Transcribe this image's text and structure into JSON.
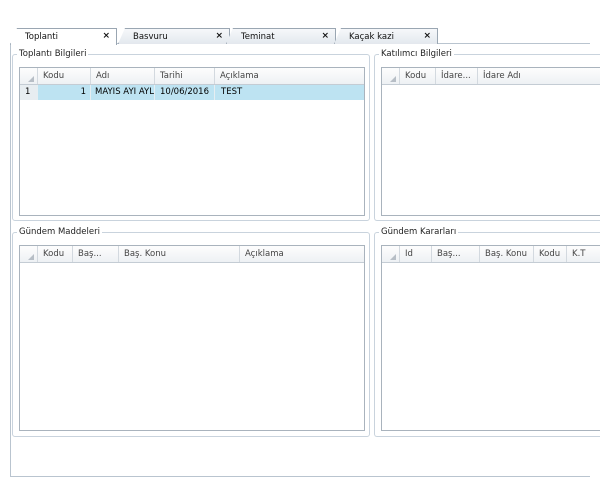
{
  "tabs": [
    {
      "label": "Toplanti",
      "active": true
    },
    {
      "label": "Basvuru",
      "active": false
    },
    {
      "label": "Teminat",
      "active": false
    },
    {
      "label": "Kaçak kazi",
      "active": false
    }
  ],
  "close_glyph": "×",
  "meeting_info": {
    "title": "Toplantı Bilgileri",
    "columns": [
      "Kodu",
      "Adı",
      "Tarihi",
      "Açıklama"
    ],
    "rows": [
      {
        "row_number": "1",
        "code": "1",
        "name": "MAYIS AYI AYLIK",
        "date": "10/06/2016",
        "description": "TEST"
      }
    ]
  },
  "participant_info": {
    "title": "Katılımcı Bilgileri",
    "columns": [
      "Kodu",
      "İdare...",
      "İdare Adı"
    ]
  },
  "agenda_items": {
    "title": "Gündem Maddeleri",
    "columns": [
      "Kodu",
      "Baş...",
      "Baş. Konu",
      "Açıklama"
    ]
  },
  "agenda_decisions": {
    "title": "Gündem Kararları",
    "columns": [
      "Id",
      "Baş...",
      "Baş. Konu",
      "Kodu",
      "K.T"
    ]
  }
}
